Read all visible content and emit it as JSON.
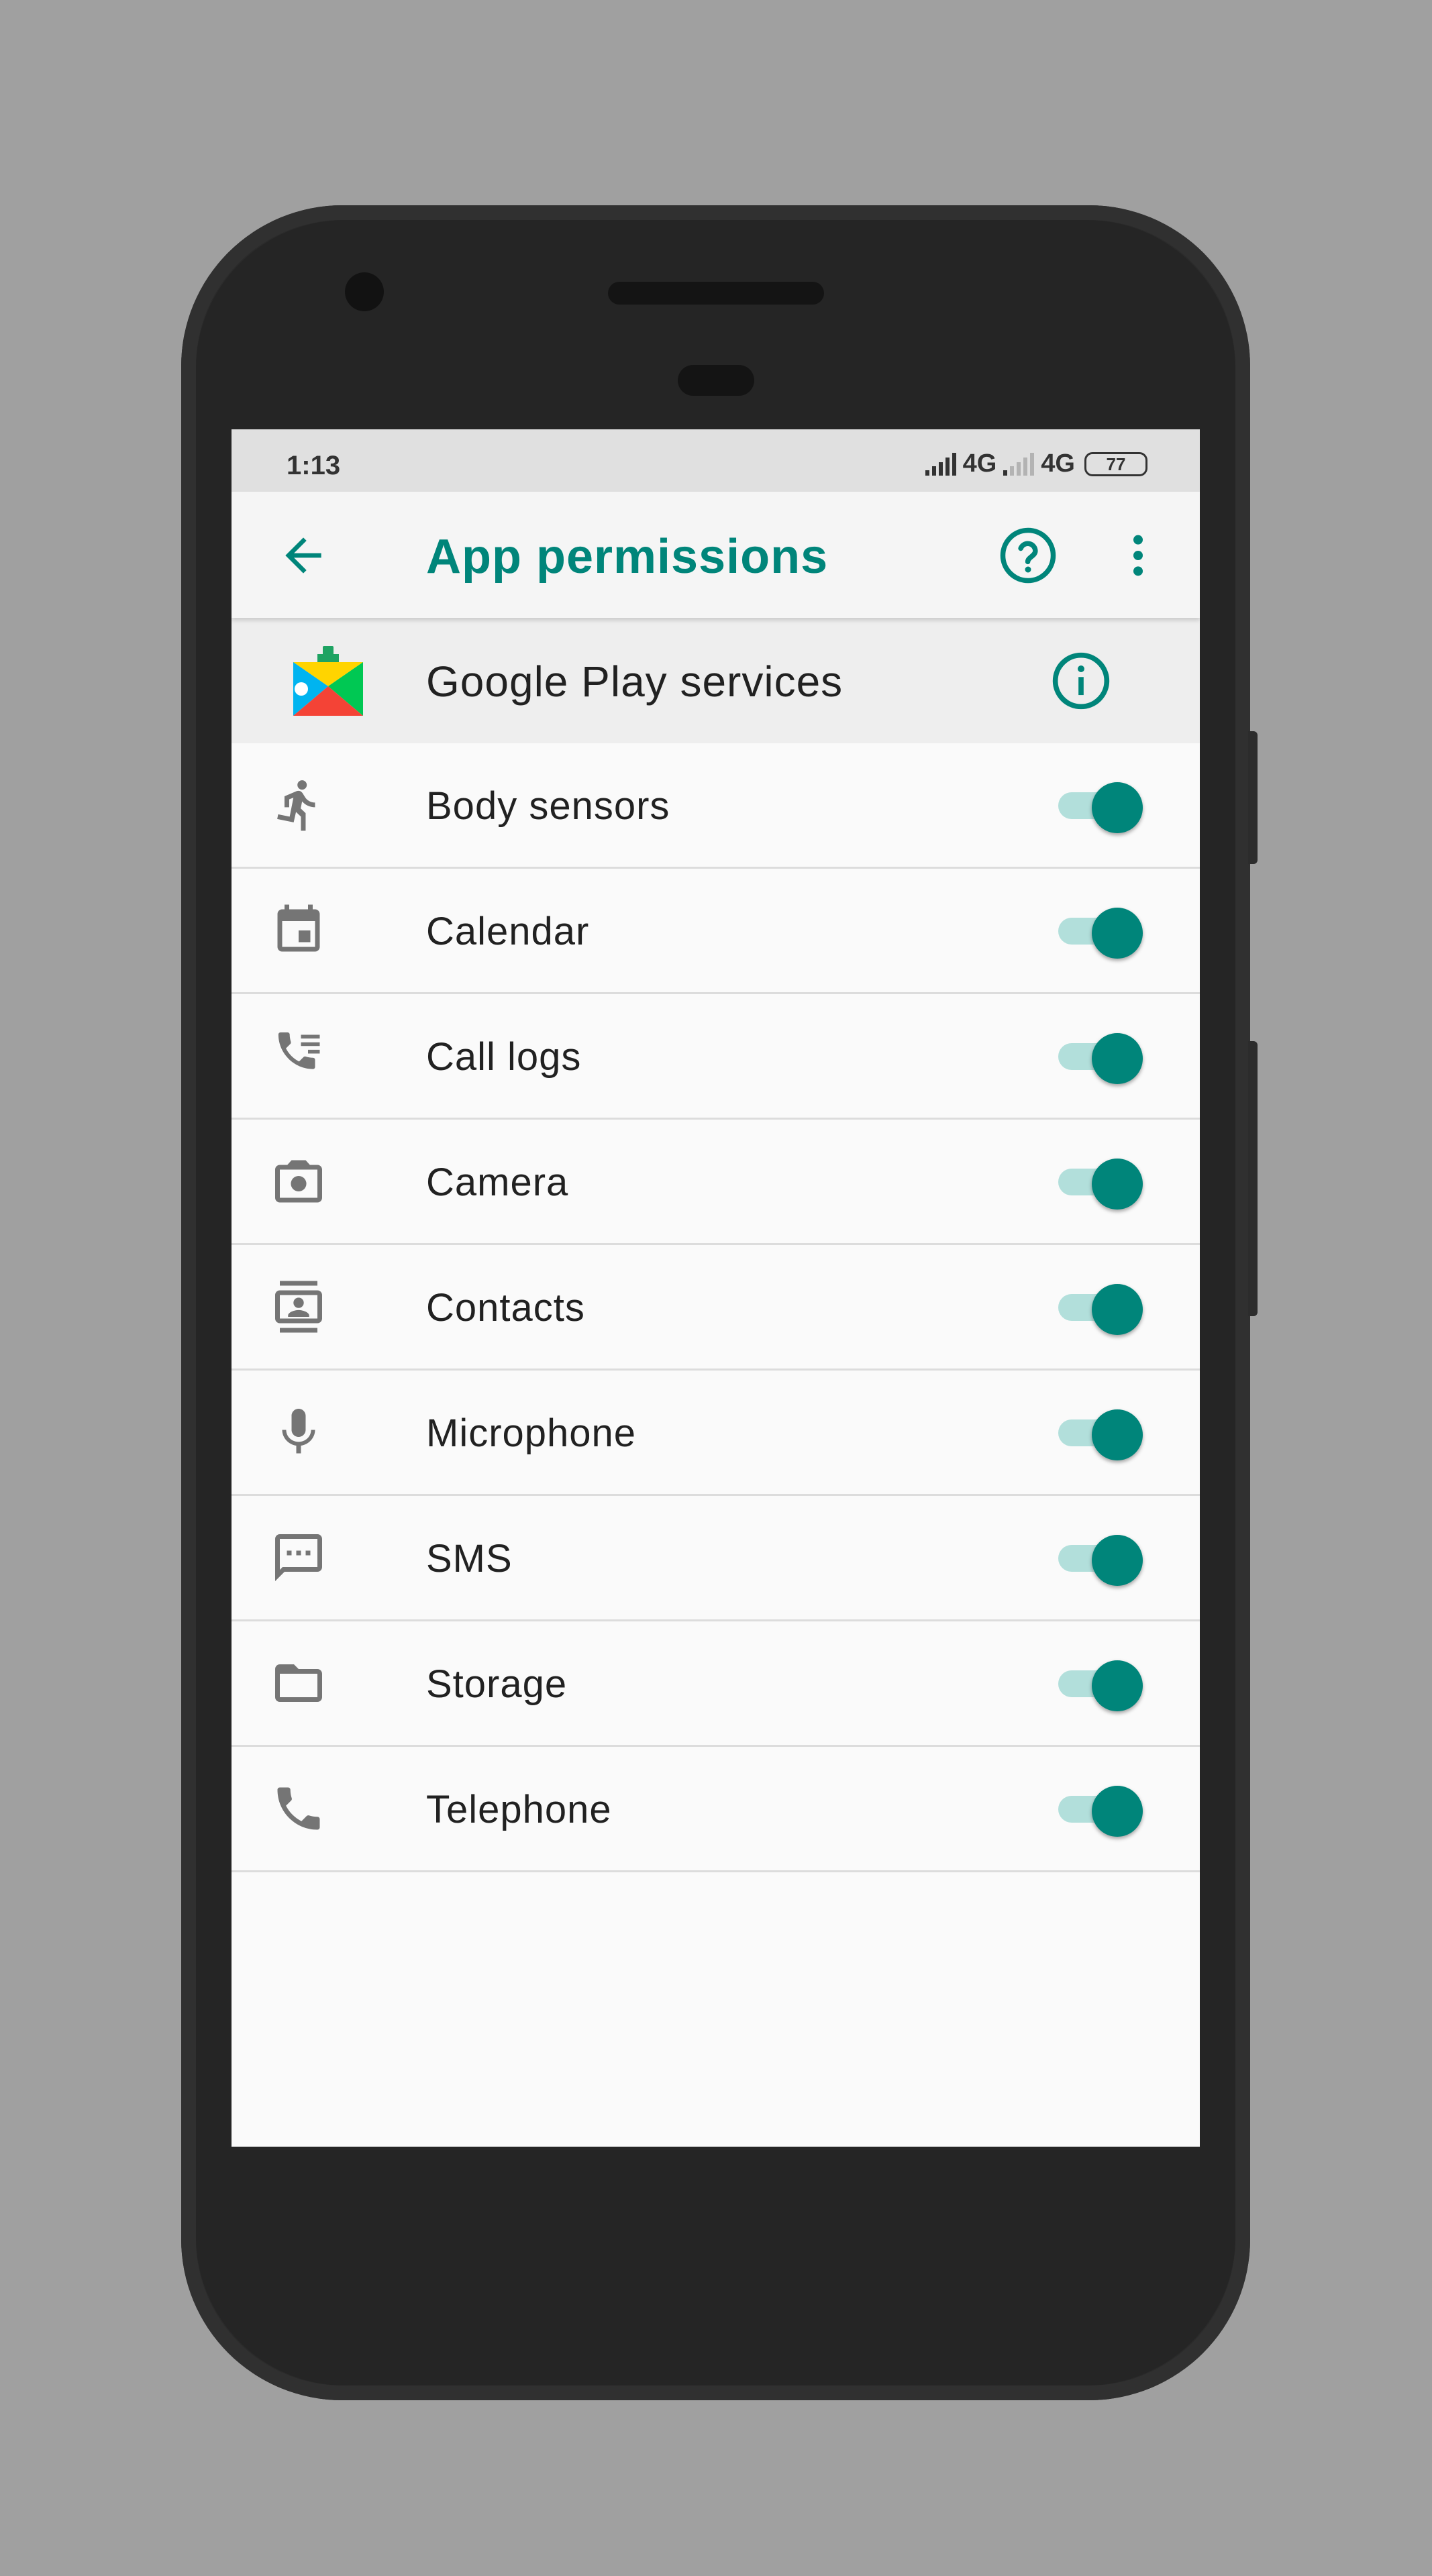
{
  "status_bar": {
    "time": "1:13",
    "network_1": "4G",
    "network_2": "4G",
    "battery": "77"
  },
  "app_bar": {
    "title": "App permissions",
    "back_icon": "arrow-left-icon",
    "help_icon": "help-circle-icon",
    "more_icon": "more-vert-icon"
  },
  "app": {
    "name": "Google Play services",
    "info_icon": "info-icon"
  },
  "permissions": [
    {
      "label": "Body sensors",
      "icon": "running-person-icon",
      "enabled": true
    },
    {
      "label": "Calendar",
      "icon": "calendar-icon",
      "enabled": true
    },
    {
      "label": "Call logs",
      "icon": "call-log-icon",
      "enabled": true
    },
    {
      "label": "Camera",
      "icon": "camera-icon",
      "enabled": true
    },
    {
      "label": "Contacts",
      "icon": "contacts-icon",
      "enabled": true
    },
    {
      "label": "Microphone",
      "icon": "microphone-icon",
      "enabled": true
    },
    {
      "label": "SMS",
      "icon": "sms-icon",
      "enabled": true
    },
    {
      "label": "Storage",
      "icon": "folder-icon",
      "enabled": true
    },
    {
      "label": "Telephone",
      "icon": "phone-icon",
      "enabled": true
    }
  ],
  "colors": {
    "accent": "#00857a",
    "toggle_track": "#b2dfdb",
    "icon_gray": "#757575"
  }
}
